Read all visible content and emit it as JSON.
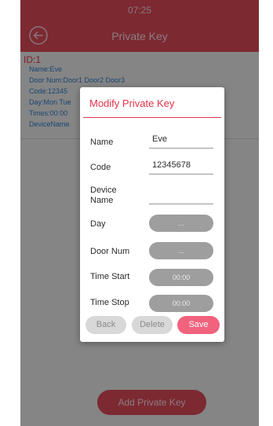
{
  "status_bar": {
    "time": "07:25"
  },
  "app_bar": {
    "title": "Private Key"
  },
  "record": {
    "id": "ID:1",
    "name": "Name:Eve",
    "door_num": "Door Num:Door1 Door2 Door3",
    "code": "Code:12345",
    "day": "Day:Mon Tue",
    "times": "Times:00:00",
    "device_name": "DeviceName"
  },
  "add_button": {
    "label": "Add Private Key"
  },
  "dialog": {
    "title": "Modify Private Key",
    "fields": {
      "name": {
        "label": "Name",
        "value": "Eve"
      },
      "code": {
        "label": "Code",
        "value": "12345678"
      },
      "device_name": {
        "label": "Device Name",
        "value": ""
      },
      "day": {
        "label": "Day",
        "value": "..."
      },
      "door_num": {
        "label": "Door Num",
        "value": "..."
      },
      "time_start": {
        "label": "Time Start",
        "value": "00:00"
      },
      "time_stop": {
        "label": "Time Stop",
        "value": "00:00"
      }
    },
    "buttons": {
      "back": "Back",
      "delete": "Delete",
      "save": "Save"
    }
  },
  "colors": {
    "primary": "#e24b5c",
    "save": "#f1627d",
    "link_blue": "#2f7fd0"
  }
}
